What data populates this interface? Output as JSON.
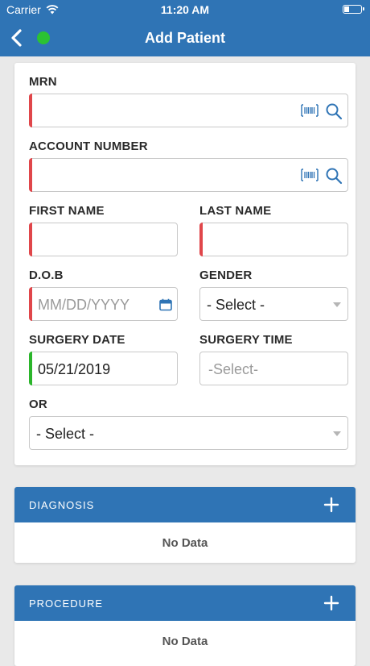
{
  "status_bar": {
    "carrier": "Carrier",
    "time": "11:20 AM"
  },
  "nav": {
    "title": "Add Patient"
  },
  "form": {
    "mrn": {
      "label": "MRN",
      "value": ""
    },
    "account_number": {
      "label": "ACCOUNT NUMBER",
      "value": ""
    },
    "first_name": {
      "label": "FIRST NAME",
      "value": ""
    },
    "last_name": {
      "label": "LAST NAME",
      "value": ""
    },
    "dob": {
      "label": "D.O.B",
      "placeholder": "MM/DD/YYYY"
    },
    "gender": {
      "label": "GENDER",
      "selected": "- Select -"
    },
    "surgery_date": {
      "label": "SURGERY DATE",
      "value": "05/21/2019"
    },
    "surgery_time": {
      "label": "SURGERY TIME",
      "placeholder": "-Select-"
    },
    "or": {
      "label": "OR",
      "selected": "- Select -"
    }
  },
  "sections": {
    "diagnosis": {
      "title": "DIAGNOSIS",
      "empty_text": "No Data"
    },
    "procedure": {
      "title": "PROCEDURE",
      "empty_text": "No Data"
    }
  },
  "colors": {
    "primary": "#2f74b5",
    "required": "#e0464a",
    "valid": "#2bb52b",
    "status_dot": "#2bc233"
  },
  "icons": [
    "wifi-icon",
    "battery-icon",
    "back-chevron-icon",
    "barcode-icon",
    "search-icon",
    "calendar-icon",
    "dropdown-caret-icon",
    "plus-icon"
  ]
}
